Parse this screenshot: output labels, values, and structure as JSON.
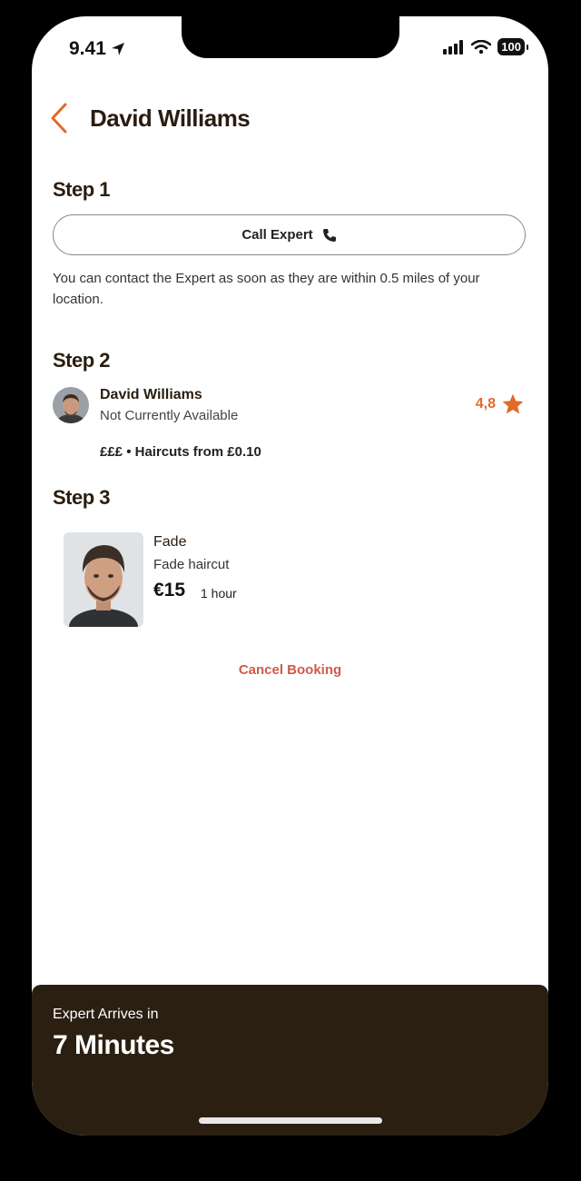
{
  "status": {
    "time": "9.41",
    "battery": "100"
  },
  "header": {
    "title": "David Williams"
  },
  "step1": {
    "title": "Step 1",
    "call_label": "Call Expert",
    "note": "You can contact the Expert as soon as they are within 0.5 miles of your location."
  },
  "step2": {
    "title": "Step 2",
    "name": "David Williams",
    "status": "Not Currently Available",
    "rating": "4,8",
    "price_line": "£££ • Haircuts from £0.10"
  },
  "step3": {
    "title": "Step 3",
    "service_name": "Fade",
    "service_desc": "Fade haircut",
    "price": "€15",
    "duration": "1 hour"
  },
  "cancel_label": "Cancel Booking",
  "bottom": {
    "label": "Expert Arrives in",
    "time": "7 Minutes"
  },
  "colors": {
    "accent": "#e06a2a",
    "dark": "#2b1f12",
    "cancel": "#d05a4a"
  }
}
